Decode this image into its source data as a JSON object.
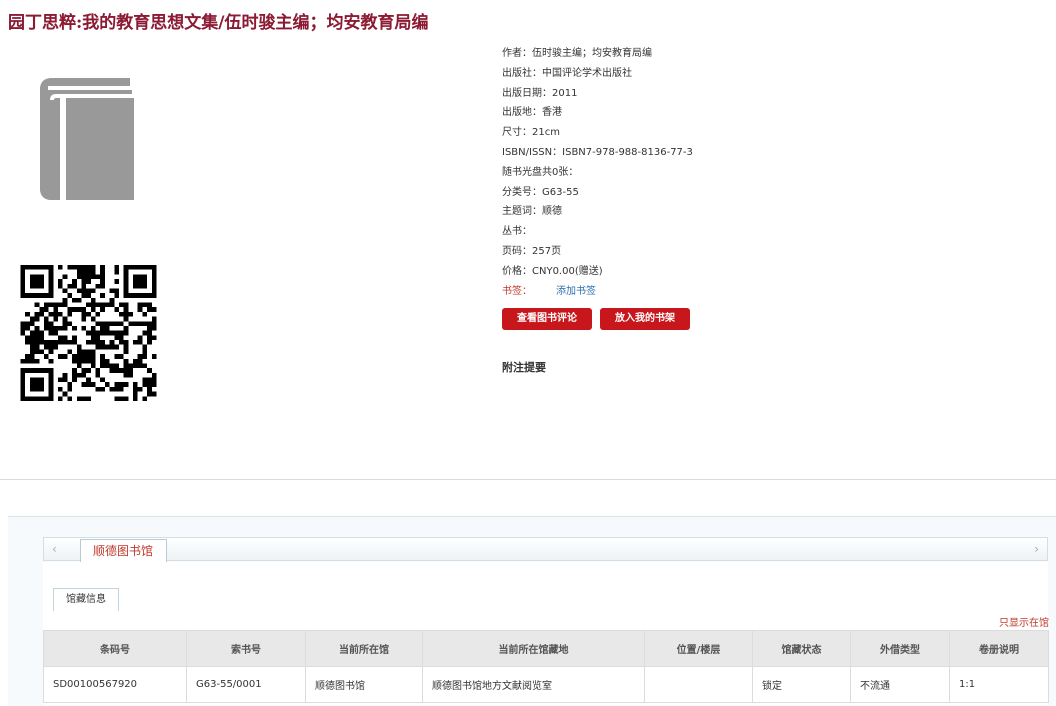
{
  "book": {
    "title": "园丁思粹:我的教育思想文集/伍时骏主编；均安教育局编"
  },
  "details": [
    {
      "label": "作者：",
      "value": "伍时骏主编；均安教育局编"
    },
    {
      "label": "出版社：",
      "value": "中国评论学术出版社"
    },
    {
      "label": "出版日期：",
      "value": "2011"
    },
    {
      "label": "出版地：",
      "value": "香港"
    },
    {
      "label": "尺寸：",
      "value": "21cm"
    },
    {
      "label": "ISBN/ISSN：",
      "value": "ISBN7-978-988-8136-77-3"
    },
    {
      "label": "随书光盘共0张：",
      "value": ""
    },
    {
      "label": "分类号：",
      "value": "G63-55"
    },
    {
      "label": "主题词：",
      "value": "顺德"
    },
    {
      "label": "丛书：",
      "value": ""
    },
    {
      "label": "页码：",
      "value": "257页"
    },
    {
      "label": "价格：",
      "value": "CNY0.00(赠送)"
    }
  ],
  "bookmark": {
    "label": "书签：",
    "link": "添加书签"
  },
  "buttons": {
    "view_reviews": "查看图书评论",
    "add_shelf": "放入我的书架"
  },
  "abstract_label": "附注提要",
  "holdings": {
    "library_tab": "顺德图书馆",
    "subtab": "馆藏信息",
    "filter_link": "只显示在馆",
    "columns": [
      "条码号",
      "索书号",
      "当前所在馆",
      "当前所在馆藏地",
      "位置/楼层",
      "馆藏状态",
      "外借类型",
      "卷册说明"
    ],
    "rows": [
      [
        "SD00100567920",
        "G63-55/0001",
        "顺德图书馆",
        "顺德图书馆地方文献阅览室",
        "",
        "锁定",
        "不流通",
        "1:1"
      ]
    ]
  },
  "icons": {
    "cover": "book-icon",
    "qr": "qr-code-icon",
    "prev": "chevron-left-icon",
    "next": "chevron-right-icon"
  },
  "colors": {
    "title": "#8b1a33",
    "accent_button": "#c8161d",
    "link": "#2a6fb0",
    "warning_text": "#c0392b"
  }
}
